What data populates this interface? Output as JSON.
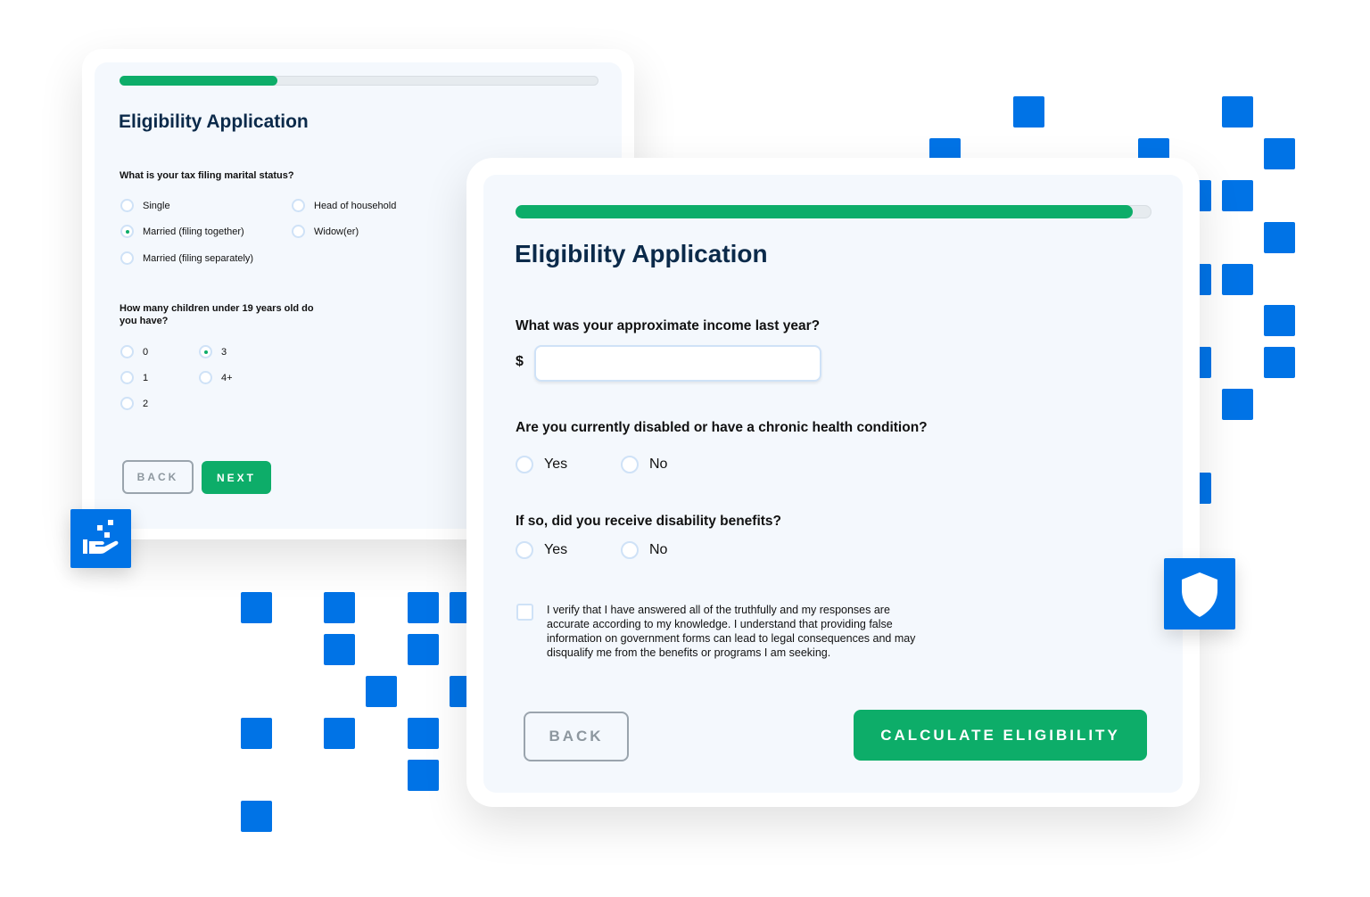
{
  "colors": {
    "accent": "#0073e6",
    "success": "#0dad69",
    "title": "#0b2a4a"
  },
  "back_form": {
    "title": "Eligibility Application",
    "progress": 0.33,
    "q1": "What is your tax filing marital status?",
    "q1_options": [
      {
        "label": "Single",
        "selected": false
      },
      {
        "label": "Head of household",
        "selected": false
      },
      {
        "label": "Married (filing together)",
        "selected": true
      },
      {
        "label": "Widow(er)",
        "selected": false
      },
      {
        "label": "Married (filing separately)",
        "selected": false
      }
    ],
    "q2": "How many children under 19 years old do you have?",
    "q2_options": [
      {
        "label": "0",
        "selected": false
      },
      {
        "label": "3",
        "selected": true
      },
      {
        "label": "1",
        "selected": false
      },
      {
        "label": "4+",
        "selected": false
      },
      {
        "label": "2",
        "selected": false
      }
    ],
    "back_label": "BACK",
    "next_label": "NEXT"
  },
  "front_form": {
    "title": "Eligibility Application",
    "progress": 0.97,
    "income_q": "What was your approximate income last year?",
    "currency": "$",
    "income_value": "",
    "disabled_q": "Are you currently disabled or have a chronic health condition?",
    "benefits_q": "If so, did you receive disability benefits?",
    "yes": "Yes",
    "no": "No",
    "verify_text": "I verify that I have answered all of the truthfully and my responses are accurate according to my knowledge. I understand that providing false information on government forms can lead to legal consequences and may disqualify me from the benefits or programs I am seeking.",
    "back_label": "BACK",
    "submit_label": "CALCULATE ELIGIBILITY"
  },
  "icons": {
    "left_badge": "hand-receiving-icon",
    "right_badge": "shield-icon"
  }
}
